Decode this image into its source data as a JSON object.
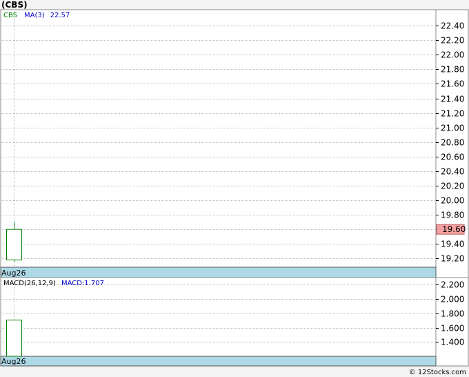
{
  "chart_title": "(CBS)",
  "copyright": "© 12Stocks.com",
  "colors": {
    "grid": "#bdbdbd",
    "date_band": "#add8e6",
    "candle_up": "#008000",
    "ticker_label": "#008000",
    "ma_label": "#0000cc",
    "last_price_bg": "#f4a0a0",
    "macd_label": "#000000",
    "macd_value": "#0000cc"
  },
  "chart_data": [
    {
      "type": "candlestick",
      "legend": {
        "ticker": "CBS",
        "ma_label": "MA(3)",
        "ma_value": "22.57"
      },
      "x": [
        "Aug26"
      ],
      "ohlc": [
        {
          "date": "Aug26",
          "open": 19.18,
          "high": 19.7,
          "low": 19.15,
          "close": 19.6
        }
      ],
      "ylim": [
        19.08,
        22.62
      ],
      "yticks": [
        "19.20",
        "19.40",
        "19.60",
        "19.80",
        "20.00",
        "20.20",
        "20.40",
        "20.60",
        "20.80",
        "21.00",
        "21.20",
        "21.40",
        "21.60",
        "21.80",
        "22.00",
        "22.20",
        "22.40"
      ],
      "last_price": "19.60",
      "date_label": "Aug26",
      "grid": true
    },
    {
      "type": "bar",
      "legend": {
        "label": "MACD(26,12,9)",
        "value_label": "MACD:1.707"
      },
      "x": [
        "Aug26"
      ],
      "values": [
        1.707
      ],
      "ylim": [
        1.2,
        2.3
      ],
      "yticks": [
        "1.400",
        "1.600",
        "1.800",
        "2.000",
        "2.200"
      ],
      "date_label": "Aug26",
      "grid": true
    }
  ]
}
